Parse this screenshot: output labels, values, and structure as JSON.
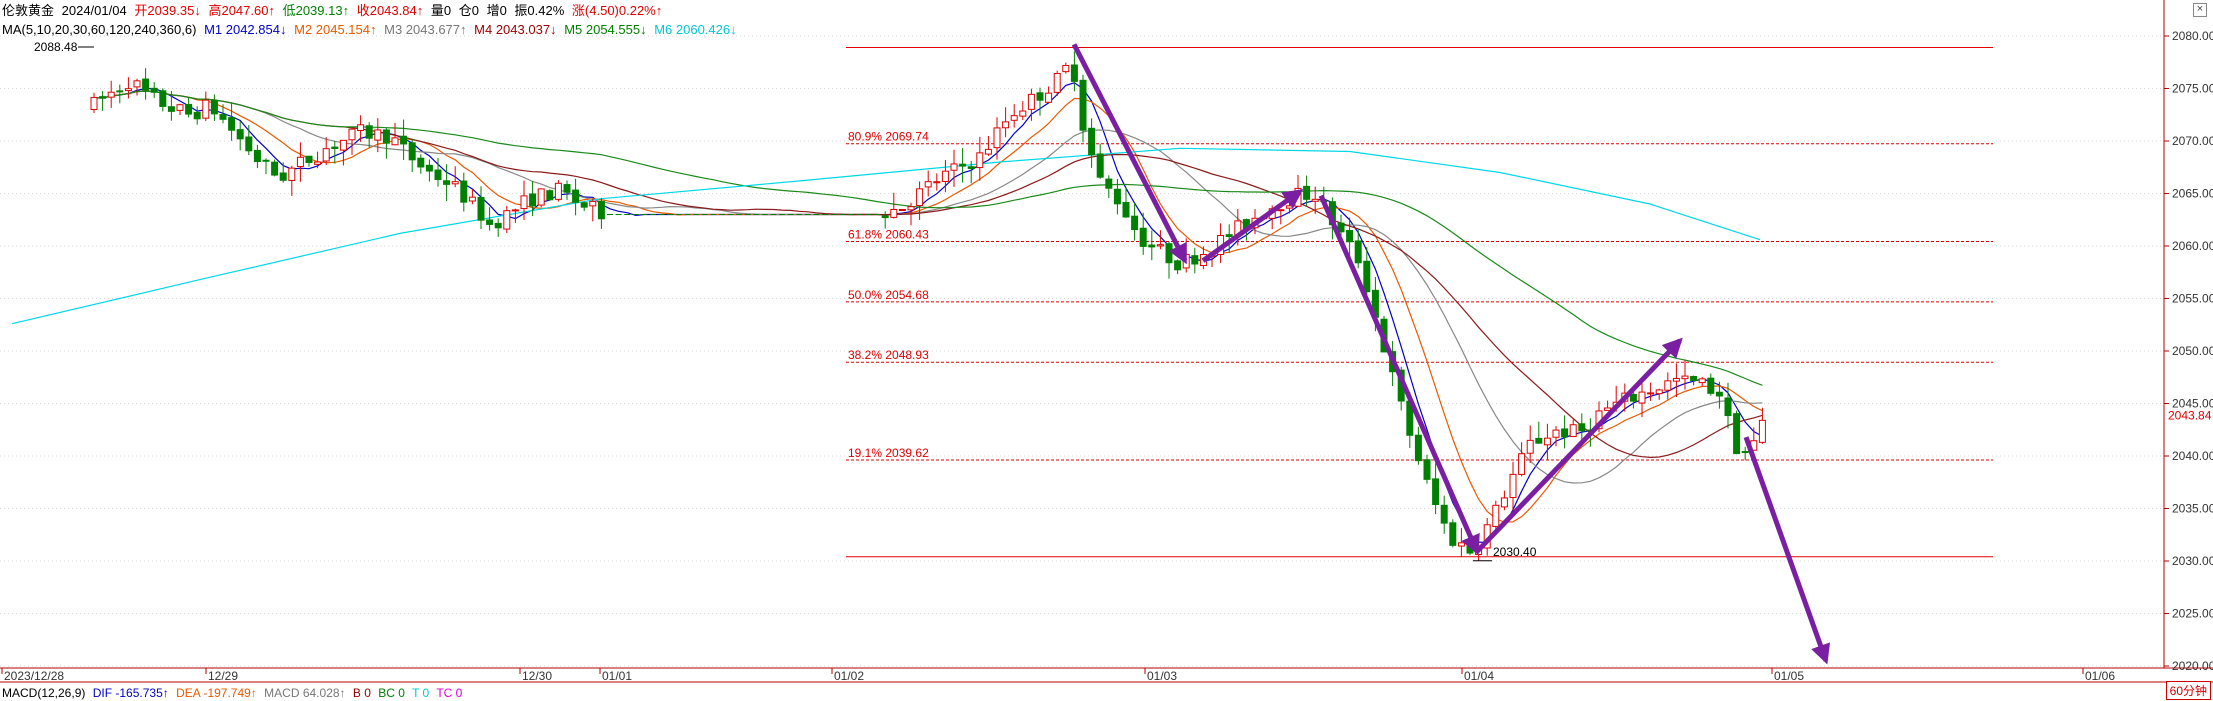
{
  "header": {
    "name": "伦敦黄金",
    "date": "2024/01/04",
    "open": "开2039.35↓",
    "high": "高2047.60↑",
    "low": "低2039.13↑",
    "close": "收2043.84↑",
    "volume": "量0",
    "position": "仓0",
    "increase": "增0",
    "amplitude": "振0.42%",
    "change": "涨(4.50)0.22%↑"
  },
  "ma_line": {
    "params": "MA(5,10,20,30,60,120,240,360,6)",
    "m1": "M1 2042.854↓",
    "m2": "M2 2045.154↑",
    "m3": "M3 2043.677↑",
    "m4": "M4 2043.037↓",
    "m5": "M5 2054.555↓",
    "m6": "M6 2060.426↓"
  },
  "macd_line": {
    "label": "MACD(12,26,9)",
    "dif": "DIF -165.735↑",
    "dea": "DEA -197.749↑",
    "macd": "MACD 64.028↑",
    "b": "B 0",
    "bc": "BC 0",
    "t": "T 0",
    "tc": "TC 0"
  },
  "controls": {
    "close_icon": "×",
    "period": "60分钟"
  },
  "colors": {
    "up": "#e00000",
    "down": "#008000",
    "m1": "#0000c8",
    "m2": "#e85a00",
    "m3": "#888888",
    "m4": "#8b1a1a",
    "m5": "#1a8a1a",
    "m6": "#00d8e8",
    "fib": "#e00000",
    "arrow": "#7a1fa2"
  },
  "chart_data": {
    "type": "candlestick",
    "timeframe": "60分钟",
    "ylim": [
      2020,
      2082
    ],
    "y_ticks": [
      "2080.00",
      "2075.00",
      "2070.00",
      "2065.00",
      "2060.00",
      "2055.00",
      "2050.00",
      "2045.00",
      "2040.00",
      "2035.00",
      "2030.00",
      "2025.00",
      "2020.00"
    ],
    "x_labels": [
      "2023/12/28",
      "12/29",
      "12/30",
      "01/01",
      "01/02",
      "01/03",
      "01/04",
      "01/05",
      "01/06"
    ],
    "last_price": "2043.84",
    "extreme_labels": [
      {
        "text": "2088.48",
        "value": 2088.48
      },
      {
        "text": "2030.40",
        "value": 2030.4
      }
    ],
    "fib_levels": [
      {
        "label": "",
        "value": 2078.9,
        "style": "solid"
      },
      {
        "label": "80.9% 2069.74",
        "value": 2069.74,
        "style": "dashed"
      },
      {
        "label": "61.8% 2060.43",
        "value": 2060.43,
        "style": "dashed"
      },
      {
        "label": "50.0% 2054.68",
        "value": 2054.68,
        "style": "dashed"
      },
      {
        "label": "38.2% 2048.93",
        "value": 2048.93,
        "style": "dashed"
      },
      {
        "label": "19.1% 2039.62",
        "value": 2039.62,
        "style": "dashed"
      },
      {
        "label": "",
        "value": 2030.4,
        "style": "solid"
      }
    ]
  }
}
